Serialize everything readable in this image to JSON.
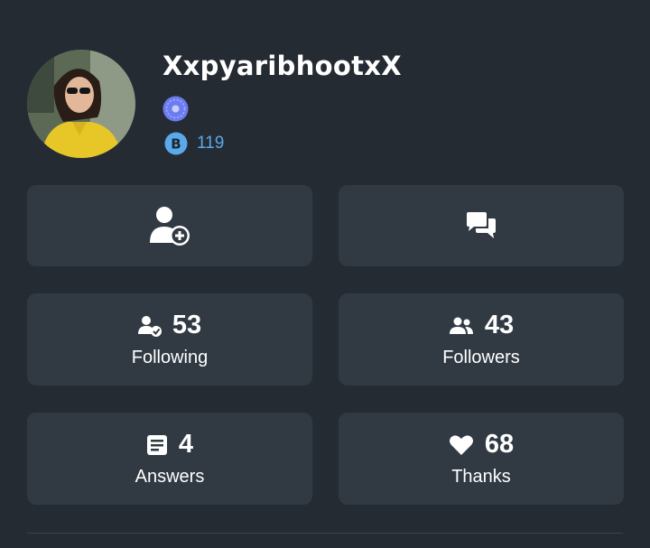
{
  "profile": {
    "username": "XxpyaribhootxX",
    "points": "119",
    "avatar_icon": "user-avatar",
    "rank_icon": "rank-badge-icon",
    "points_icon": "brainly-points-icon"
  },
  "actions": {
    "add_friend_icon": "add-friend-icon",
    "message_icon": "message-icon"
  },
  "stats": {
    "following": {
      "value": "53",
      "label": "Following"
    },
    "followers": {
      "value": "43",
      "label": "Followers"
    },
    "answers": {
      "value": "4",
      "label": "Answers"
    },
    "thanks": {
      "value": "68",
      "label": "Thanks"
    }
  },
  "colors": {
    "background": "#252b33",
    "card": "#313a43",
    "points": "#5aa9ea",
    "rank_badge": "#6c7cf0"
  }
}
